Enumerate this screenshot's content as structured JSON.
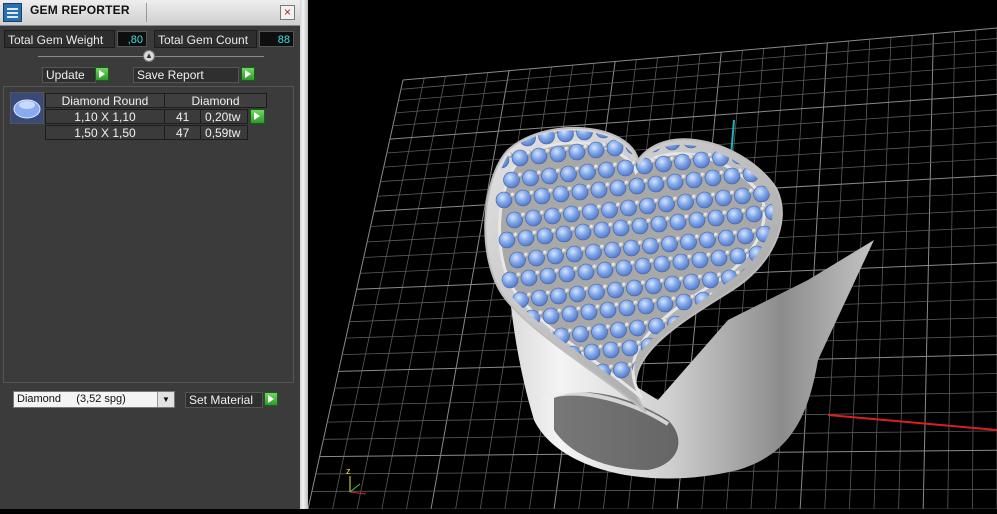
{
  "window": {
    "title": "GEM REPORTER",
    "close_glyph": "×"
  },
  "totals": {
    "weight_label": "Total Gem Weight",
    "weight_value": ",80",
    "count_label": "Total Gem Count",
    "count_value": "88"
  },
  "actions": {
    "update_label": "Update",
    "save_report_label": "Save Report"
  },
  "gem_table": {
    "headers": [
      "Diamond Round",
      "Diamond"
    ],
    "rows": [
      {
        "size": "1,10 X 1,10",
        "count": "41",
        "weight": "0,20tw"
      },
      {
        "size": "1,50 X 1,50",
        "count": "47",
        "weight": "0,59tw"
      }
    ]
  },
  "material": {
    "selected": "Diamond     (3,52 spg)",
    "set_label": "Set Material"
  },
  "viewport": {
    "axis_label": "z"
  },
  "colors": {
    "panel_bg": "#3b3b3b",
    "value_text": "#3fe0e0",
    "go_green": "#3aaa33",
    "gem_blue": "#7ea6e8",
    "metal": "#d8d8d8"
  },
  "icons": [
    "gem-reporter-app-icon",
    "close-icon",
    "collapse-arrow-icon",
    "play-arrow-icon",
    "gem-thumbnail-icon",
    "dropdown-arrow-icon",
    "axis-triad-icon"
  ]
}
